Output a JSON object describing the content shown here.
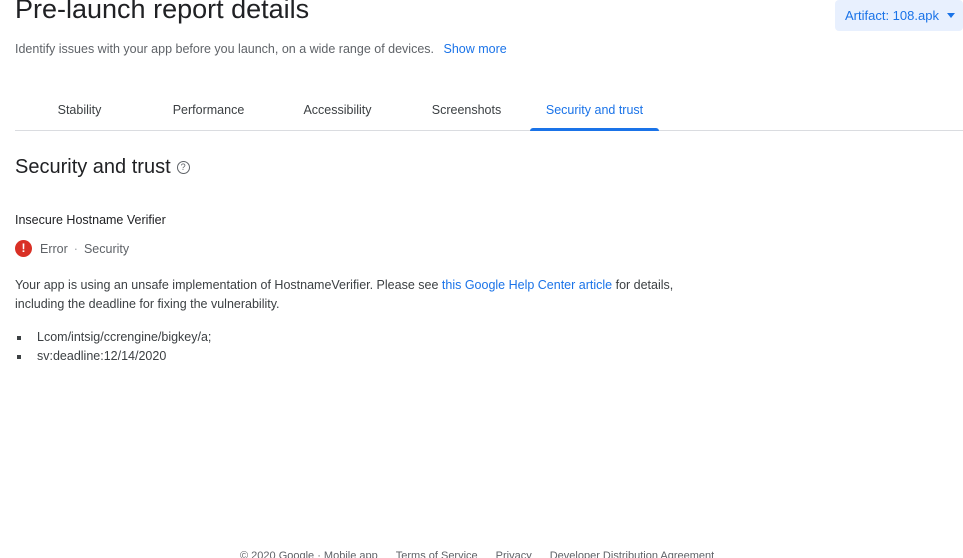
{
  "header": {
    "title": "Pre-launch report details",
    "subtitle": "Identify issues with your app before you launch, on a wide range of devices.",
    "show_more": "Show more",
    "artifact_label": "Artifact: 108.apk"
  },
  "tabs": [
    {
      "label": "Stability",
      "active": false
    },
    {
      "label": "Performance",
      "active": false
    },
    {
      "label": "Accessibility",
      "active": false
    },
    {
      "label": "Screenshots",
      "active": false
    },
    {
      "label": "Security and trust",
      "active": true
    }
  ],
  "section": {
    "title": "Security and trust",
    "help_icon": "help-circle-icon"
  },
  "issue": {
    "title": "Insecure Hostname Verifier",
    "severity_icon": "error-icon",
    "severity": "Error",
    "separator": "·",
    "category": "Security",
    "description_before": "Your app is using an unsafe implementation of HostnameVerifier. Please see ",
    "description_link": "this Google Help Center article",
    "description_after": " for details, including the deadline for fixing the vulnerability.",
    "details": [
      "Lcom/intsig/ccrengine/bigkey/a;",
      "sv:deadline:12/14/2020"
    ]
  },
  "footer": {
    "copyright": "© 2020 Google · Mobile app",
    "terms": "Terms of Service",
    "privacy": "Privacy",
    "developer_agreement": "Developer Distribution Agreement"
  },
  "colors": {
    "accent": "#1a73e8",
    "error": "#d93025",
    "artifact_bg": "#e8f0fe"
  }
}
